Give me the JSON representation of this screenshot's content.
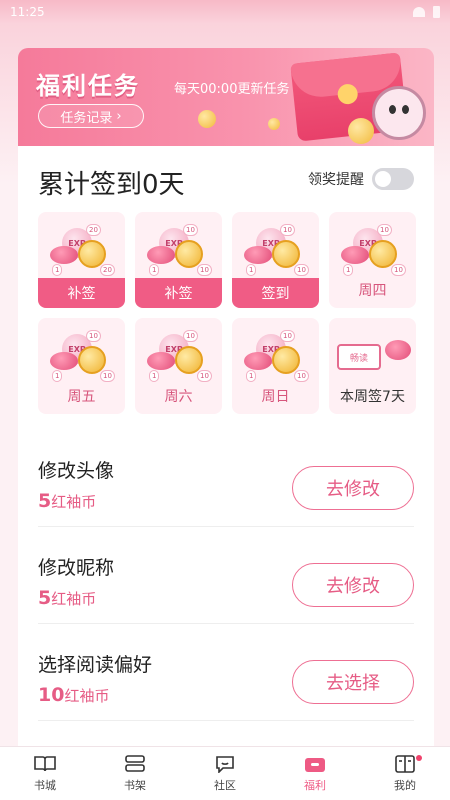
{
  "status_bar": {
    "time": "11:25"
  },
  "banner": {
    "title": "福利任务",
    "subtitle": "每天00:00更新任务",
    "record_label": "任务记录",
    "record_chevron": "chevron-right-icon",
    "accent": "#f57a9a"
  },
  "signin": {
    "title": "累计签到0天",
    "remind_label": "领奖提醒",
    "remind_on": false,
    "days": [
      {
        "label": "补签",
        "state": "filled",
        "exp": "EXP",
        "small": "1",
        "big": "20"
      },
      {
        "label": "补签",
        "state": "filled",
        "exp": "EXP",
        "small": "1",
        "big": "10"
      },
      {
        "label": "签到",
        "state": "filled",
        "exp": "EXP",
        "small": "1",
        "big": "10"
      },
      {
        "label": "周四",
        "state": "plain",
        "exp": "EXP",
        "small": "1",
        "big": "10"
      },
      {
        "label": "周五",
        "state": "plain",
        "exp": "EXP",
        "small": "1",
        "big": "10"
      },
      {
        "label": "周六",
        "state": "plain",
        "exp": "EXP",
        "small": "1",
        "big": "10"
      },
      {
        "label": "周日",
        "state": "plain",
        "exp": "EXP",
        "small": "1",
        "big": "10"
      }
    ],
    "week_bonus": {
      "label": "本周签7天",
      "ticket": "畅读"
    }
  },
  "tasks": [
    {
      "name": "修改头像",
      "amount": "5",
      "unit": "红袖币",
      "button": "去修改"
    },
    {
      "name": "修改昵称",
      "amount": "5",
      "unit": "红袖币",
      "button": "去修改"
    },
    {
      "name": "选择阅读偏好",
      "amount": "10",
      "unit": "红袖币",
      "button": "去选择"
    }
  ],
  "tabbar": {
    "items": [
      {
        "label": "书城",
        "icon": "open-book-icon"
      },
      {
        "label": "书架",
        "icon": "bookshelf-icon"
      },
      {
        "label": "社区",
        "icon": "chat-bubble-icon"
      },
      {
        "label": "福利",
        "icon": "gift-box-icon",
        "active": true
      },
      {
        "label": "我的",
        "icon": "profile-book-icon",
        "badge": true
      }
    ]
  }
}
